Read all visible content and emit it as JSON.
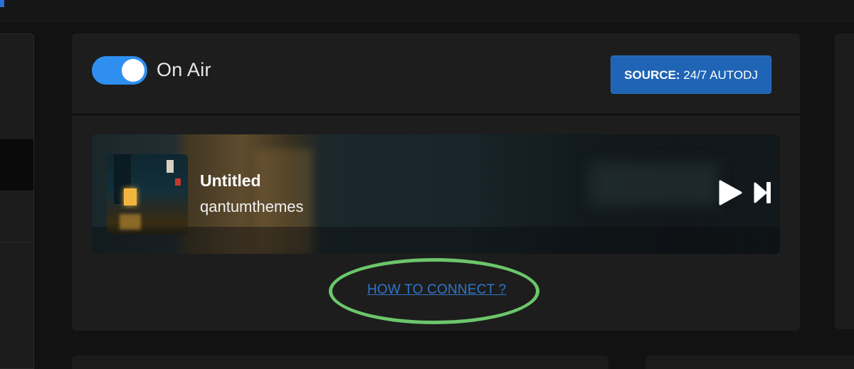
{
  "header": {
    "toggle_label": "On Air",
    "toggle_on": true,
    "source_prefix": "SOURCE:",
    "source_value": "24/7 AUTODJ"
  },
  "player": {
    "title": "Untitled",
    "artist": "qantumthemes"
  },
  "connect": {
    "link_label": "HOW TO CONNECT ?"
  },
  "colors": {
    "toggle": "#2f8ff0",
    "source_button": "#1f64b5",
    "link": "#2f76c9",
    "highlight_ring": "#6cc66a"
  },
  "icons": [
    "play-icon",
    "skip-next-icon"
  ]
}
